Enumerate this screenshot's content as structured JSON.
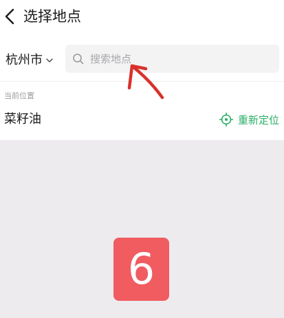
{
  "header": {
    "title": "选择地点",
    "back_icon": "chevron-left-icon"
  },
  "search": {
    "city": "杭州市",
    "placeholder": "搜索地点",
    "search_icon": "search-icon",
    "dropdown_icon": "chevron-down-icon"
  },
  "current": {
    "section_label": "当前位置",
    "location_name": "菜籽油",
    "relocate_label": "重新定位",
    "relocate_icon": "crosshair-icon"
  },
  "overlay": {
    "badge_number": "6"
  },
  "colors": {
    "accent_green": "#2aae67",
    "annotation_red": "#d8322b",
    "badge_red": "#f05c60",
    "page_background": "#edebee"
  }
}
